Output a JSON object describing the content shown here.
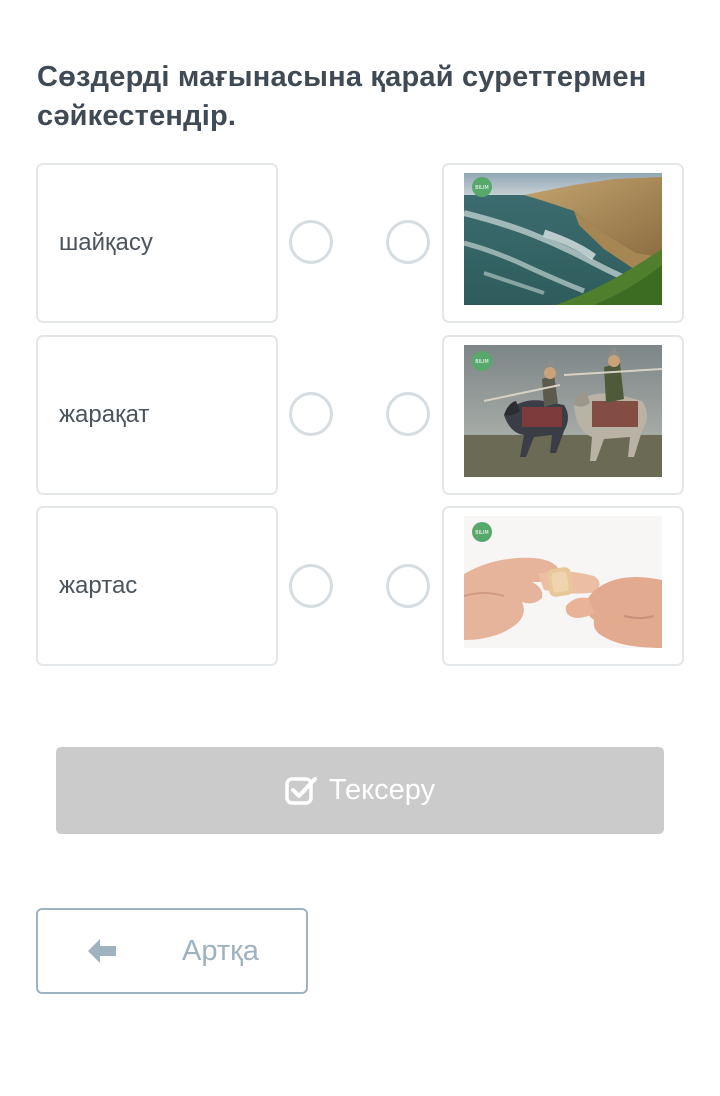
{
  "question": "Сөздерді мағынасына қарай суреттермен сәйкестендір.",
  "words": [
    {
      "text": "шайқасу"
    },
    {
      "text": "жарақат"
    },
    {
      "text": "жартас"
    }
  ],
  "images": [
    {
      "icon": "sea-cliff-image"
    },
    {
      "icon": "horse-warriors-battle-image"
    },
    {
      "icon": "bandaged-finger-image"
    }
  ],
  "check_button": {
    "label": "Тексеру",
    "icon": "check-square-icon"
  },
  "back_button": {
    "label": "Артқа",
    "icon": "arrow-left-icon"
  },
  "colors": {
    "question_text": "#3f4a55",
    "card_border": "#e3e7ea",
    "radio_border": "#d6dde2",
    "check_button_bg": "#cbcbcb",
    "back_button_accent": "#9fb2bf"
  }
}
